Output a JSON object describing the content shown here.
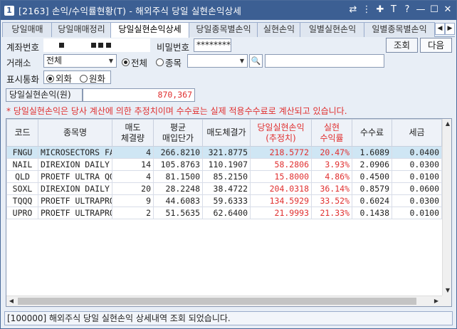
{
  "window": {
    "title": "[2163] 손익/수익률현황(T) - 해외주식 당일 실현손익상세",
    "icon_label": "1",
    "buttons": [
      {
        "name": "link-icon",
        "glyph": "⇄"
      },
      {
        "name": "help-menu-icon",
        "glyph": "⋮"
      },
      {
        "name": "pin-icon",
        "glyph": "✚"
      },
      {
        "name": "text-icon",
        "glyph": "T"
      },
      {
        "name": "help-icon",
        "glyph": "?"
      },
      {
        "name": "minimize-icon",
        "glyph": "—"
      },
      {
        "name": "maximize-icon",
        "glyph": "☐"
      },
      {
        "name": "close-icon",
        "glyph": "✕"
      }
    ]
  },
  "tabs": [
    {
      "label": "당일매매",
      "active": false
    },
    {
      "label": "당일매매정리",
      "active": false
    },
    {
      "label": "당일실현손익상세",
      "active": true
    },
    {
      "label": "당일종목별손익",
      "active": false
    },
    {
      "label": "실현손익",
      "active": false
    },
    {
      "label": "일별실현손익",
      "active": false
    },
    {
      "label": "일별종목별손익",
      "active": false
    }
  ],
  "form": {
    "account_label": "계좌번호",
    "password_label": "비밀번호",
    "password_value": "********",
    "search_button": "조회",
    "next_button": "다음",
    "exchange_label": "거래소",
    "exchange_value": "전체",
    "radio_all": "전체",
    "radio_stock": "종목",
    "stock_code_value": "",
    "stock_name_value": "",
    "currency_label": "표시통화",
    "radio_foreign": "외화",
    "radio_won": "원화",
    "profit_label": "당일실현손익(원)",
    "profit_value": "870,367"
  },
  "note": "* 당일실현손익은 당사 계산에 의한 추정치이며 수수료는 실제 적용수수료로 계산되고 있습니다.",
  "table": {
    "headers": [
      "코드",
      "종목명",
      "매도\n체결량",
      "평균\n매입단가",
      "매도체결가",
      "당일실현손익\n(추정치)",
      "실현\n수익률",
      "수수료",
      "세금"
    ],
    "rows": [
      [
        "FNGU",
        "MICROSECTORS FAN",
        "4",
        "266.8210",
        "321.8775",
        "218.5772",
        "20.47%",
        "1.6089",
        "0.0400"
      ],
      [
        "NAIL",
        "DIREXION DAILY H",
        "14",
        "105.8763",
        "110.1907",
        "58.2806",
        "3.93%",
        "2.0906",
        "0.0300"
      ],
      [
        "QLD",
        "PROETF ULTRA QQQ",
        "4",
        "81.1500",
        "85.2150",
        "15.8000",
        "4.86%",
        "0.4500",
        "0.0100"
      ],
      [
        "SOXL",
        "DIREXION DAILY S",
        "20",
        "28.2248",
        "38.4722",
        "204.0318",
        "36.14%",
        "0.8579",
        "0.0600"
      ],
      [
        "TQQQ",
        "PROETF ULTRAPRO",
        "9",
        "44.6083",
        "59.6333",
        "134.5929",
        "33.52%",
        "0.6024",
        "0.0300"
      ],
      [
        "UPRO",
        "PROETF ULTRAPRO",
        "2",
        "51.5635",
        "62.6400",
        "21.9993",
        "21.33%",
        "0.1438",
        "0.0100"
      ]
    ],
    "selected_row": 0
  },
  "status": "[100000] 해외주식 당일 실현손익 상세내역 조회 되었습니다.",
  "colors": {
    "titlebar": "#3c5f93",
    "profit": "#e03030",
    "selected_row": "#cfe6f4"
  }
}
